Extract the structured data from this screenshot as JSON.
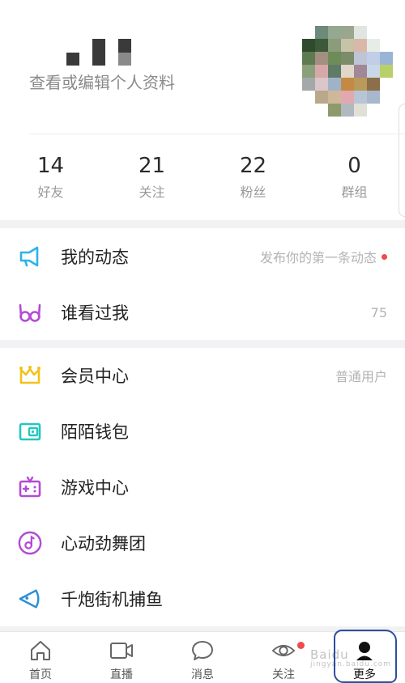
{
  "profile": {
    "edit_link": "查看或编辑个人资料"
  },
  "stats": [
    {
      "value": "14",
      "label": "好友"
    },
    {
      "value": "21",
      "label": "关注"
    },
    {
      "value": "22",
      "label": "粉丝"
    },
    {
      "value": "0",
      "label": "群组"
    }
  ],
  "menu": {
    "section1": [
      {
        "label": "我的动态",
        "right": "发布你的第一条动态",
        "icon": "megaphone-icon",
        "color": "#2ab4e8",
        "dot": true
      },
      {
        "label": "谁看过我",
        "right": "75",
        "icon": "glasses-icon",
        "color": "#b44ad6"
      }
    ],
    "section2": [
      {
        "label": "会员中心",
        "right": "普通用户",
        "icon": "crown-icon",
        "color": "#f2c21a"
      },
      {
        "label": "陌陌钱包",
        "right": "",
        "icon": "wallet-icon",
        "color": "#23c7c0"
      },
      {
        "label": "游戏中心",
        "right": "",
        "icon": "gamepad-icon",
        "color": "#b44ad6"
      },
      {
        "label": "心动劲舞团",
        "right": "",
        "icon": "music-disc-icon",
        "color": "#b44ad6"
      },
      {
        "label": "千炮街机捕鱼",
        "right": "",
        "icon": "fish-icon",
        "color": "#2a8fd6"
      }
    ]
  },
  "nav": [
    {
      "label": "首页",
      "icon": "home-icon"
    },
    {
      "label": "直播",
      "icon": "video-camera-icon"
    },
    {
      "label": "消息",
      "icon": "chat-bubble-icon"
    },
    {
      "label": "关注",
      "icon": "eye-icon",
      "dot": true
    },
    {
      "label": "更多",
      "icon": "profile-icon",
      "active": true
    }
  ],
  "watermark": {
    "main": "Baidu",
    "sub": "jingyan.baidu.com"
  }
}
